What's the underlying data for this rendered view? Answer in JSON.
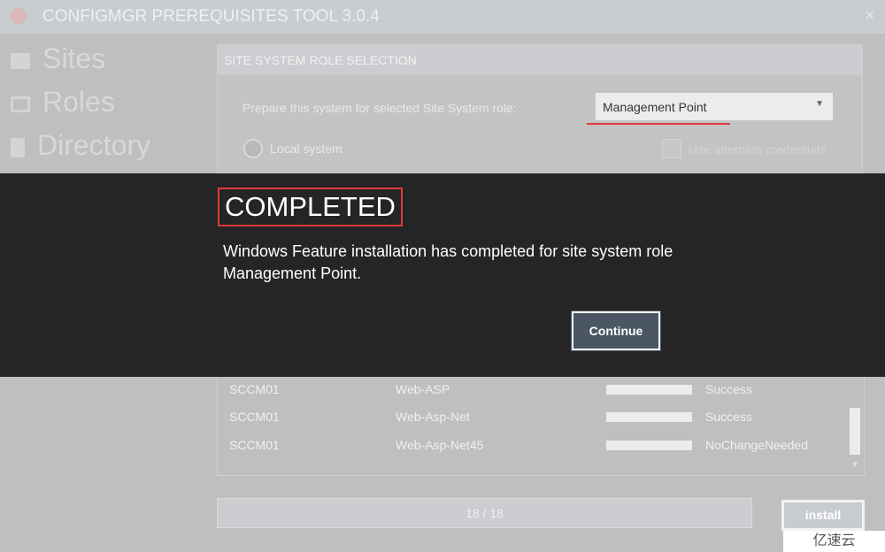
{
  "window": {
    "title": "CONFIGMGR PREREQUISITES TOOL 3.0.4",
    "close": "×"
  },
  "sidebar": {
    "items": [
      {
        "label": "Sites",
        "icon": "server-list-icon"
      },
      {
        "label": "Roles",
        "icon": "window-icon"
      },
      {
        "label": "Directory",
        "icon": "book-icon"
      }
    ]
  },
  "panel": {
    "header": "SITE SYSTEM ROLE SELECTION",
    "prepare_label": "Prepare this system for selected Site System role:",
    "role_value": "Management Point",
    "local_label": "Local system",
    "alt_cred_label": "Use alternate credentials"
  },
  "dialog": {
    "title": "COMPLETED",
    "message": "Windows Feature installation has completed for site system role Management Point.",
    "continue_label": "Continue"
  },
  "table": {
    "rows": [
      {
        "server": "SCCM01",
        "feature": "Web-ASP",
        "progress": 100,
        "status": "Success"
      },
      {
        "server": "SCCM01",
        "feature": "Web-Asp-Net",
        "progress": 100,
        "status": "Success"
      },
      {
        "server": "SCCM01",
        "feature": "Web-Asp-Net45",
        "progress": 100,
        "status": "NoChangeNeeded"
      }
    ]
  },
  "progress": {
    "text": "18 / 18",
    "value": 1.0
  },
  "install_label": "install",
  "watermark": "亿速云",
  "colors": {
    "accent_red": "#e03b3b",
    "overlay": "#252525",
    "button": "#4a5663"
  }
}
